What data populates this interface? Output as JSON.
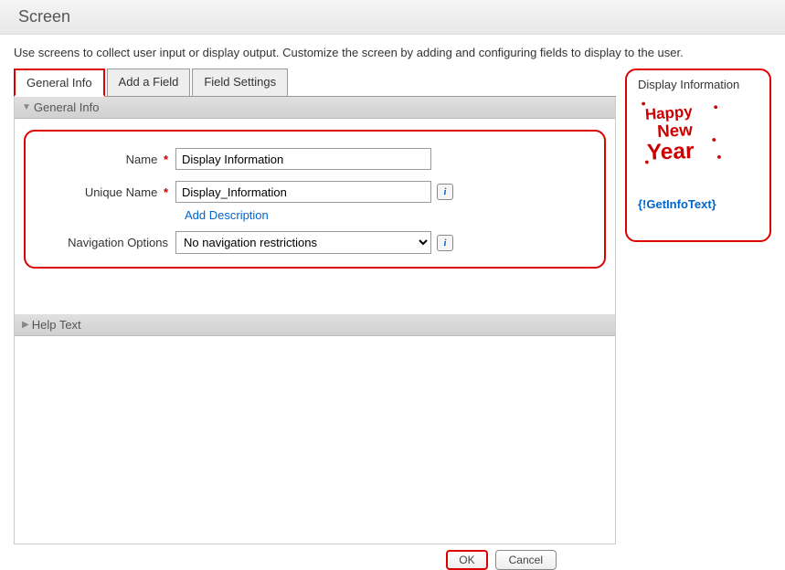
{
  "header": {
    "title": "Screen"
  },
  "description": "Use screens to collect user input or display output. Customize the screen by adding and configuring fields to display to the user.",
  "tabs": {
    "general_info": "General Info",
    "add_a_field": "Add a Field",
    "field_settings": "Field Settings"
  },
  "sections": {
    "general_info_header": "General Info",
    "help_text_header": "Help Text"
  },
  "fields": {
    "name_label": "Name",
    "name_value": "Display Information",
    "unique_name_label": "Unique Name",
    "unique_name_value": "Display_Information",
    "add_description": "Add Description",
    "nav_options_label": "Navigation Options",
    "nav_options_value": "No navigation restrictions"
  },
  "preview": {
    "title": "Display Information",
    "image_alt": "Happy New Year",
    "placeholder_text": "{!GetInfoText}"
  },
  "buttons": {
    "ok": "OK",
    "cancel": "Cancel"
  },
  "info_icon": "i"
}
